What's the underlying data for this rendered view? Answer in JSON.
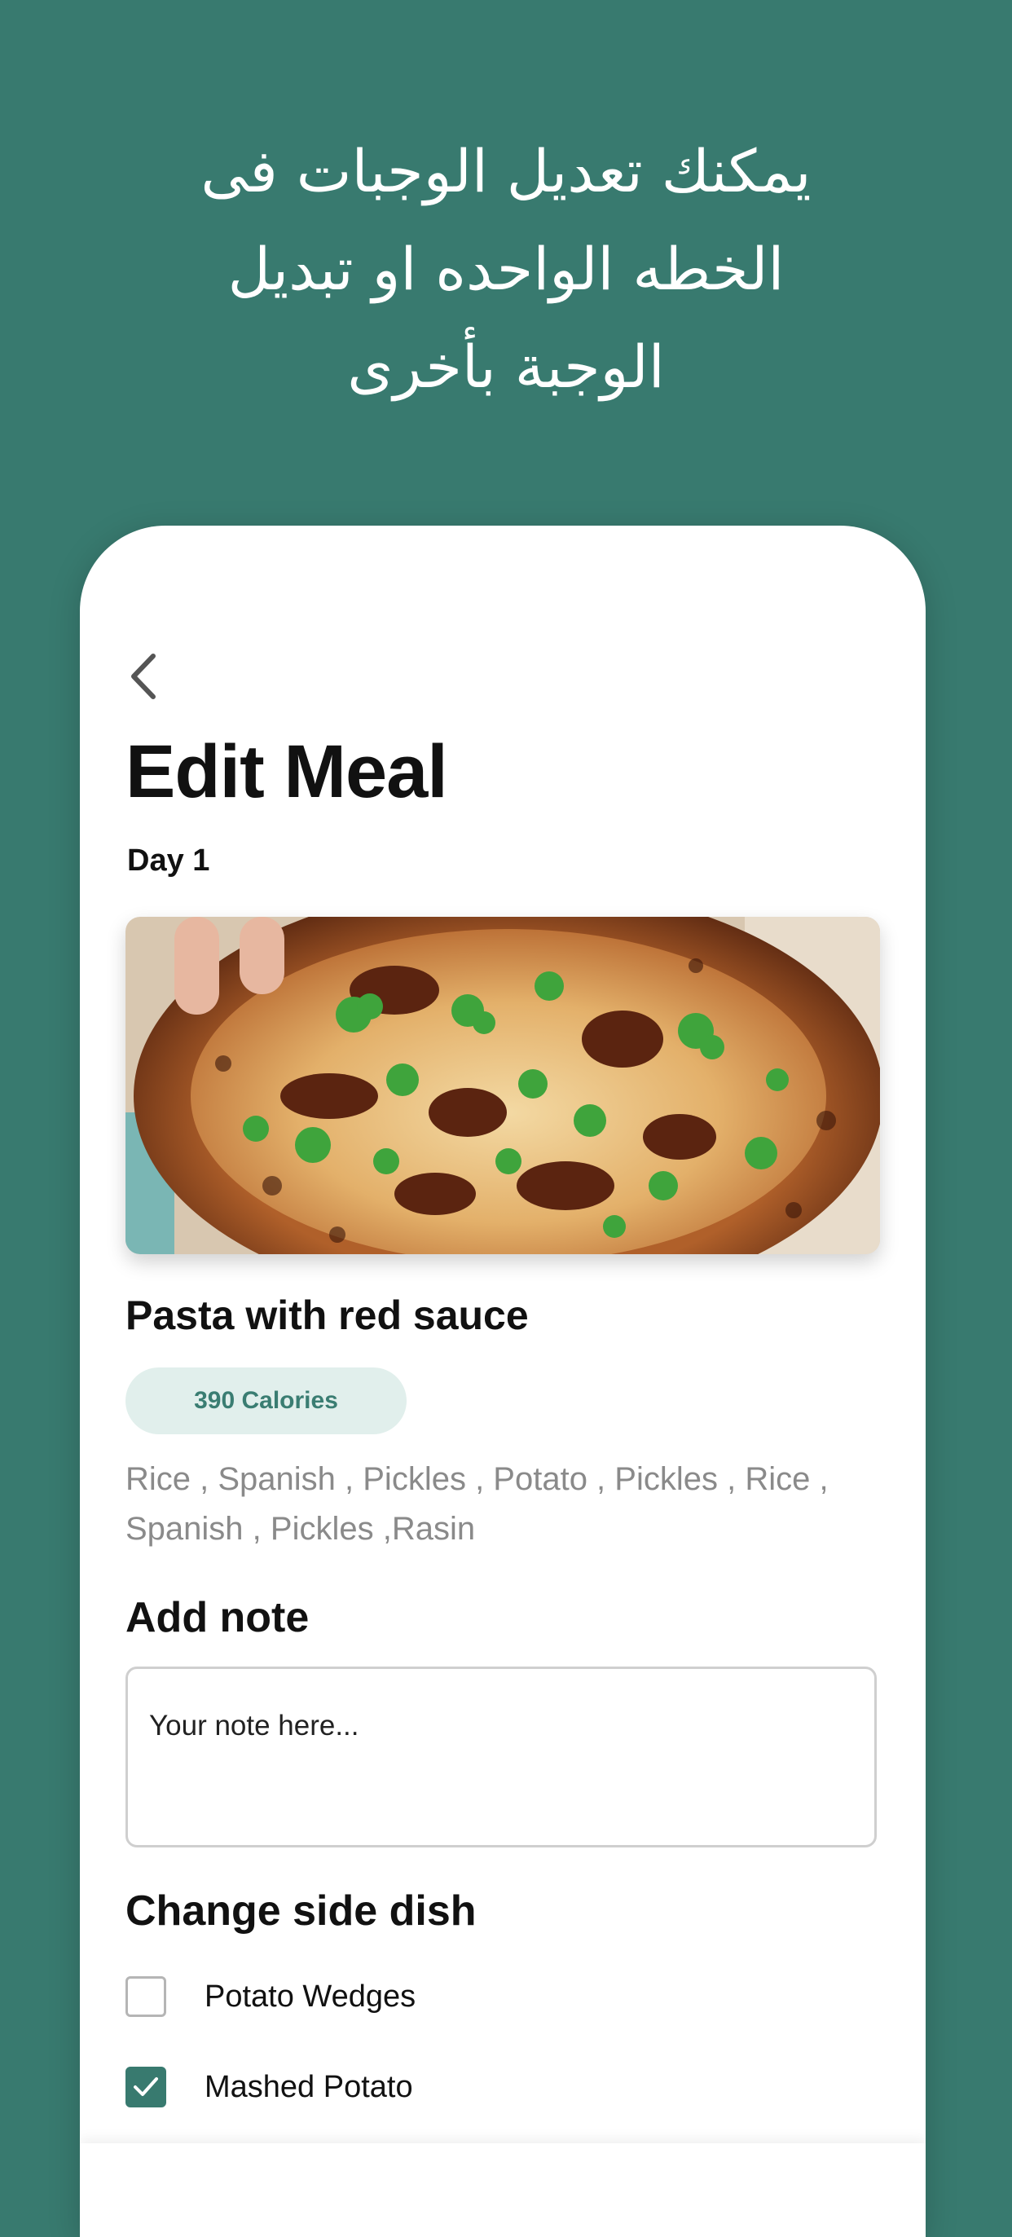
{
  "headline": {
    "line1": "يمكنك تعديل الوجبات فى",
    "line2": "الخطه الواحده او تبديل",
    "line3": "الوجبة بأخرى"
  },
  "screen": {
    "title": "Edit Meal",
    "day": "Day 1",
    "meal": {
      "name": "Pasta with red sauce",
      "calories": "390 Calories",
      "ingredients_line1": "Rice , Spanish , Pickles , Potato , Pickles , Rice ,",
      "ingredients_line2": "Spanish , Pickles ,Rasin"
    },
    "note": {
      "label": "Add note",
      "placeholder": "Your note here..."
    },
    "side_dish": {
      "label": "Change side dish",
      "options": [
        {
          "label": "Potato Wedges",
          "checked": false
        },
        {
          "label": "Mashed Potato",
          "checked": true
        }
      ]
    }
  },
  "colors": {
    "brand": "#387a6f",
    "badge_bg": "#e1efec",
    "badge_text": "#3a7d72"
  },
  "icons": {
    "back": "chevron-left-icon",
    "check": "check-icon"
  }
}
